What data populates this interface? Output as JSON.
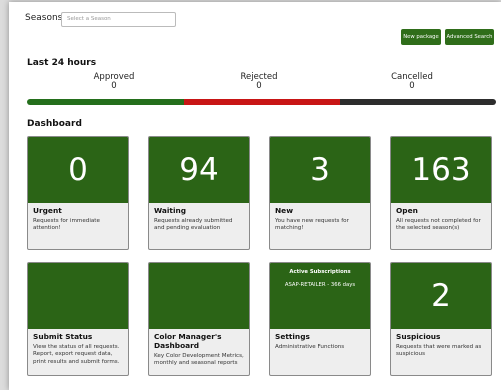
{
  "seasons": {
    "label": "Seasons:",
    "placeholder": "Select a Season"
  },
  "buttons": {
    "new_package": "New package",
    "advanced_search": "Advanced Search"
  },
  "last24": {
    "title": "Last 24 hours",
    "approved": {
      "label": "Approved",
      "value": "0"
    },
    "rejected": {
      "label": "Rejected",
      "value": "0"
    },
    "cancelled": {
      "label": "Cancelled",
      "value": "0"
    },
    "colors": {
      "approved": "#246f1c",
      "rejected": "#c81515",
      "cancelled": "#2d2d2d"
    }
  },
  "dashboard": {
    "title": "Dashboard",
    "cards": [
      {
        "value": "0",
        "title": "Urgent",
        "desc": "Requests for immediate attention!"
      },
      {
        "value": "94",
        "title": "Waiting",
        "desc": "Requests already submitted and pending evaluation"
      },
      {
        "value": "3",
        "title": "New",
        "desc": "You have new requests for matching!"
      },
      {
        "value": "163",
        "title": "Open",
        "desc": "All requests not completed for the selected season(s)"
      },
      {
        "value": "",
        "title": "Submit Status",
        "desc": "View the status of all requests. Report, export request data, print results and submit forms."
      },
      {
        "value": "",
        "title": "Color Manager's Dashboard",
        "desc": "Key Color Development Metrics, monthly and seasonal reports"
      },
      {
        "value": "",
        "title": "Settings",
        "desc": "Administrative Functions",
        "subscriptions": {
          "heading": "Active Subscriptions",
          "item": "ASAP-RETAILER - 366 days"
        }
      },
      {
        "value": "2",
        "title": "Suspicious",
        "desc": "Requests that were marked as suspicious"
      }
    ]
  },
  "theme": {
    "accent_green": "#2b6416",
    "button_green": "#2f6d1a"
  }
}
